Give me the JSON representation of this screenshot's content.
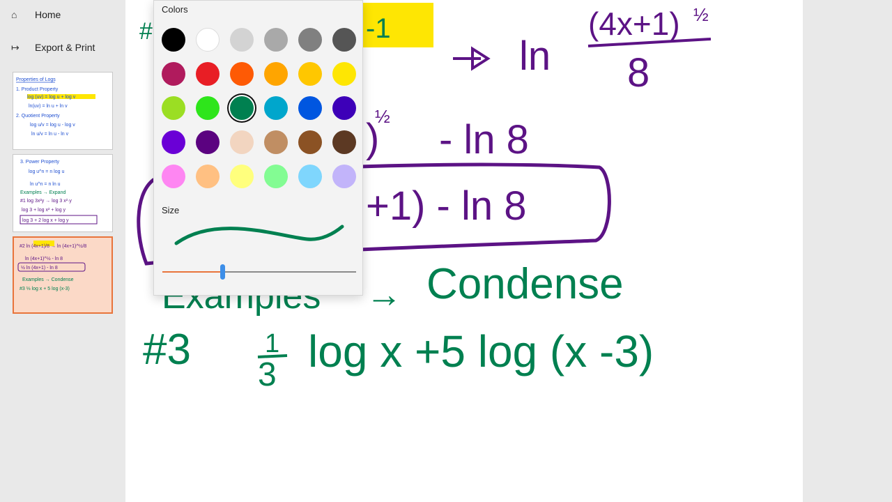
{
  "sidebar": {
    "home_label": "Home",
    "export_label": "Export & Print",
    "thumbnails": [
      {
        "name": "page-thumbnail-1",
        "lines": [
          "Properties of Logs",
          "1. Product Property",
          "log (uv) = log u + log v",
          "ln(uv) = ln u + ln v",
          "2. Quotient Property",
          "log u/v = log u - log v",
          "ln u/v = ln u - ln v"
        ]
      },
      {
        "name": "page-thumbnail-2",
        "lines": [
          "3. Power Property",
          "log u^n = n log u",
          "ln u^n = n ln u",
          "Examples → Expand",
          "#1  log 3x²y → log 3 x²·y",
          "log 3 + log x² + log y",
          "log 3 + 2 log x + log y"
        ]
      },
      {
        "name": "page-thumbnail-3",
        "lines": [
          "#2  ln (4x+1)/8 → ln (4x+1)^½/8",
          "ln (4x+1)^½ - ln 8",
          "½ ln (4x+1) - ln 8",
          "Examples → Condense",
          "#3  ⅓ log x + 5 log (x-3)"
        ]
      }
    ]
  },
  "panel": {
    "colors_heading": "Colors",
    "size_heading": "Size",
    "selected_color": "#008050",
    "swatches": [
      [
        "#000000",
        "#ffffff",
        "#d3d3d3",
        "#a9a9a9",
        "#808080",
        "#555555"
      ],
      [
        "#b01b5d",
        "#e81e25",
        "#fe5a05",
        "#ffa500",
        "#ffc700",
        "#fee603"
      ],
      [
        "#9bde23",
        "#2ee51b",
        "#008050",
        "#00a6cc",
        "#0056e0",
        "#3d00b8"
      ],
      [
        "#6a00d6",
        "#5b0280",
        "#f2d5c0",
        "#c08e63",
        "#8b5224",
        "#5c3923"
      ],
      [
        "#fe86f2",
        "#ffc082",
        "#ffff7d",
        "#83fc93",
        "#7fd6fd",
        "#c2b4fa"
      ]
    ],
    "size_value": 0.31
  },
  "canvas": {
    "ink_green": "#008050",
    "ink_purple": "#5c1385",
    "highlight_yellow": "#fee603",
    "top_text": "(4x+1)",
    "exponent": "½",
    "denominator": "8",
    "ln": "ln",
    "minus_ln8": "- ln 8",
    "boxed_expression": "+1) - ln 8",
    "example_label": "Examples",
    "arrow": "→",
    "condense_label": "Condense",
    "problem_number": "#3",
    "third_num": "1",
    "third_den": "3",
    "problem_rest": "log x  +5  log (x -3)"
  }
}
